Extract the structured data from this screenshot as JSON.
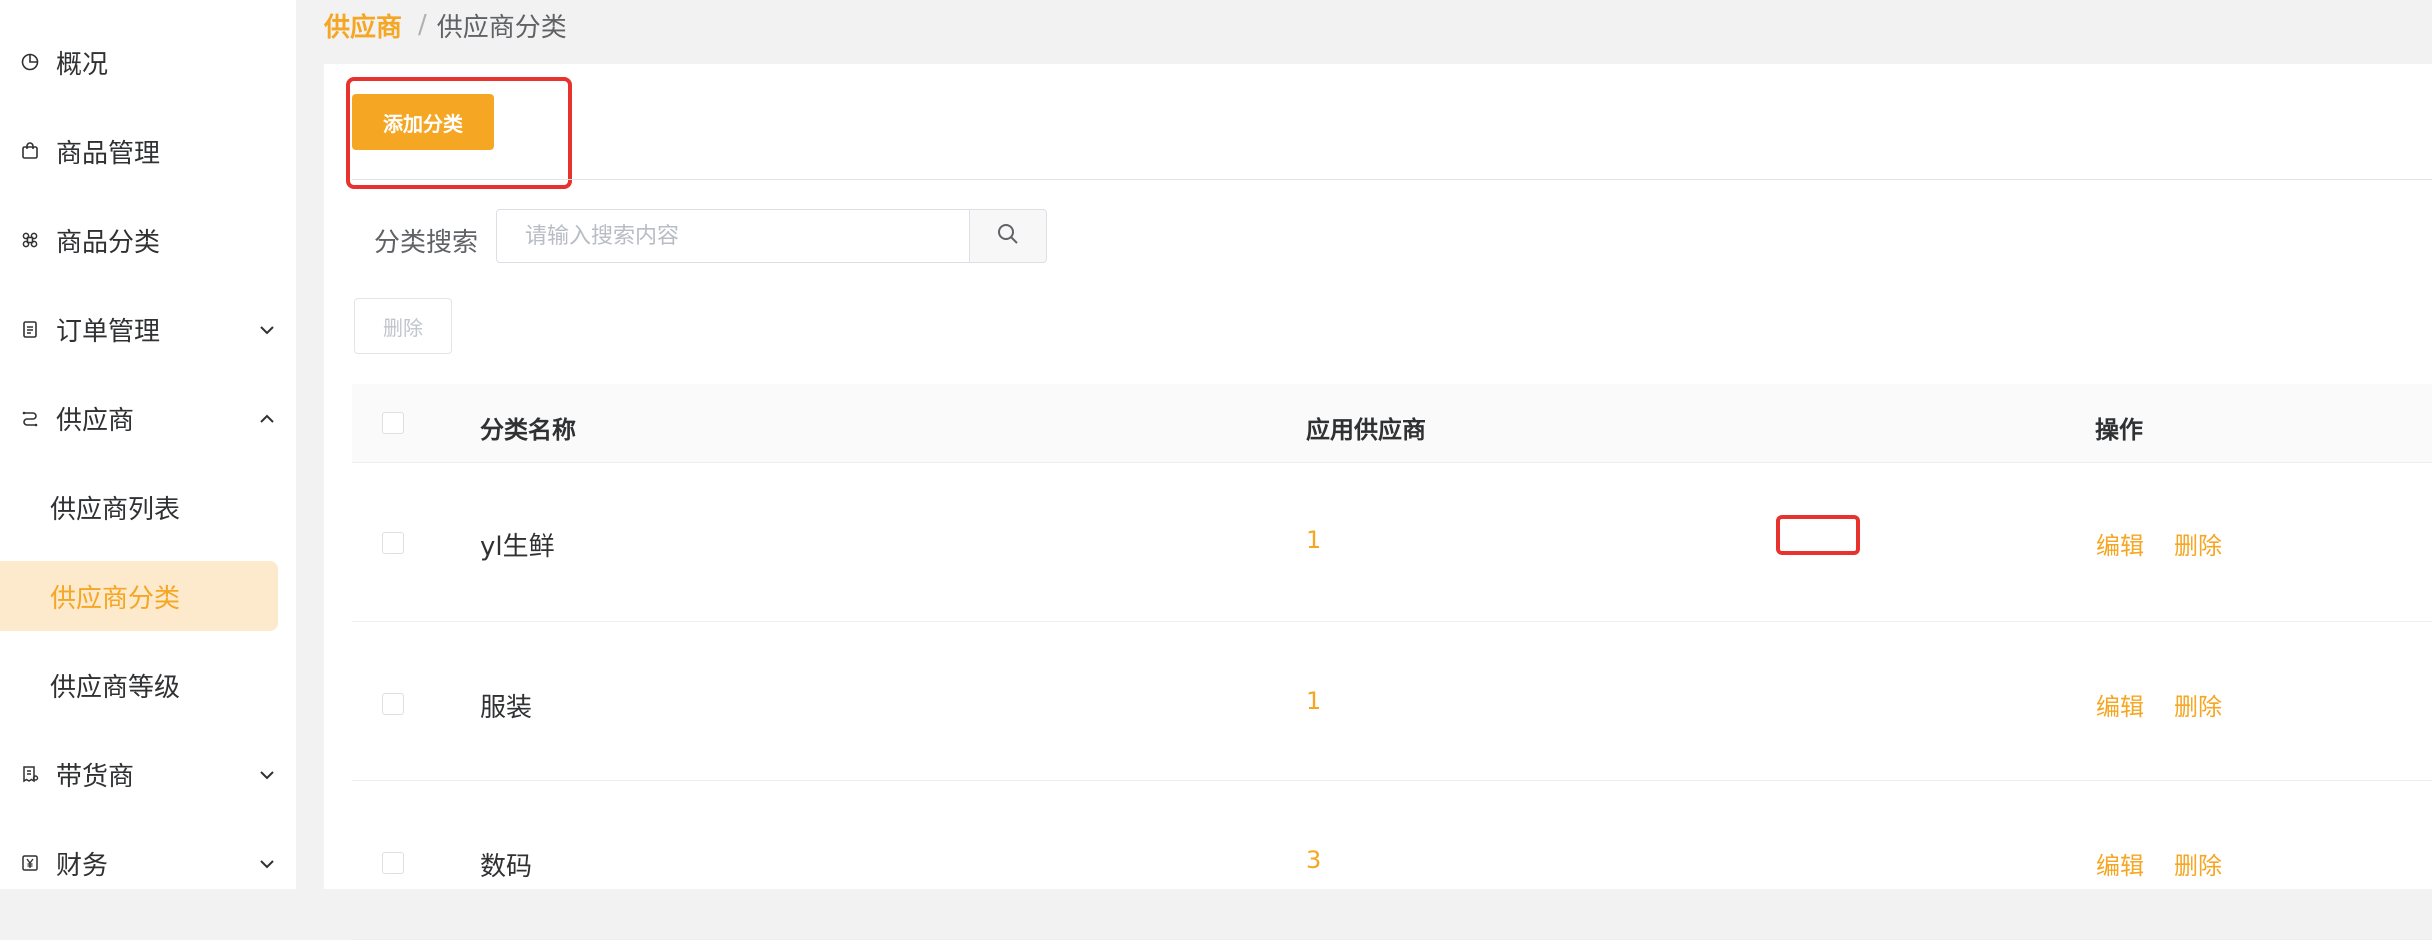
{
  "sidebar": {
    "items": [
      {
        "label": "概况",
        "icon": "pie-chart-icon"
      },
      {
        "label": "商品管理",
        "icon": "shopping-bag-icon"
      },
      {
        "label": "商品分类",
        "icon": "command-icon"
      },
      {
        "label": "订单管理",
        "icon": "clipboard-icon"
      },
      {
        "label": "供应商",
        "icon": "supplier-icon"
      }
    ],
    "sub_items": [
      {
        "label": "供应商列表"
      },
      {
        "label": "供应商分类"
      },
      {
        "label": "供应商等级"
      }
    ],
    "items_after": [
      {
        "label": "带货商",
        "icon": "receipt-icon"
      },
      {
        "label": "财务",
        "icon": "yen-icon"
      }
    ]
  },
  "breadcrumb": {
    "root": "供应商",
    "separator": "/",
    "current": "供应商分类"
  },
  "toolbar": {
    "add_label": "添加分类",
    "delete_label": "删除"
  },
  "search": {
    "label": "分类搜索",
    "placeholder": "请输入搜索内容"
  },
  "table": {
    "columns": [
      "分类名称",
      "应用供应商",
      "操作"
    ],
    "rows": [
      {
        "name": "yl生鲜",
        "count": "1",
        "edit": "编辑",
        "delete": "删除"
      },
      {
        "name": "服装",
        "count": "1",
        "edit": "编辑",
        "delete": "删除"
      },
      {
        "name": "数码",
        "count": "3",
        "edit": "编辑",
        "delete": "删除"
      }
    ]
  },
  "colors": {
    "accent": "#f5a623",
    "highlight": "#e8322d",
    "active_bg": "#fde9cc"
  }
}
